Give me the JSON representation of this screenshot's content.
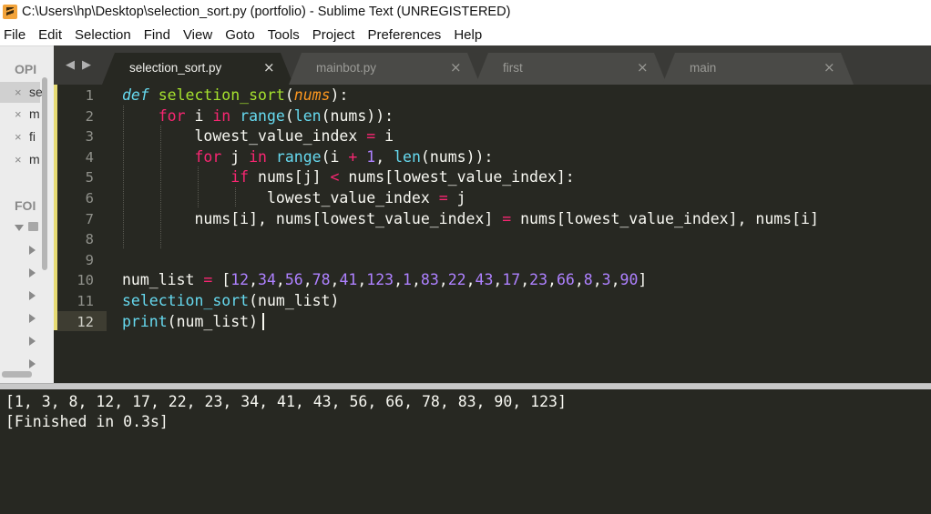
{
  "window": {
    "title": "C:\\Users\\hp\\Desktop\\selection_sort.py (portfolio) - Sublime Text (UNREGISTERED)"
  },
  "menu": [
    "File",
    "Edit",
    "Selection",
    "Find",
    "View",
    "Goto",
    "Tools",
    "Project",
    "Preferences",
    "Help"
  ],
  "sidebar": {
    "open_files_heading": "OPI",
    "open_files": [
      {
        "close": "×",
        "name": "se"
      },
      {
        "close": "×",
        "name": "m"
      },
      {
        "close": "×",
        "name": "fi"
      },
      {
        "close": "×",
        "name": "m"
      }
    ],
    "folders_heading": "FOI"
  },
  "tabs": [
    {
      "label": "selection_sort.py",
      "active": true,
      "close": "×"
    },
    {
      "label": "mainbot.py",
      "active": false,
      "close": "×"
    },
    {
      "label": "first",
      "active": false,
      "close": "×"
    },
    {
      "label": "main",
      "active": false,
      "close": "×"
    }
  ],
  "tab_nav": {
    "prev": "◀",
    "next": "▶"
  },
  "editor": {
    "lines": [
      {
        "num": "1",
        "tokens": [
          {
            "t": "def",
            "c": "d"
          },
          {
            "t": " ",
            "c": ""
          },
          {
            "t": "selection_sort",
            "c": "f"
          },
          {
            "t": "(",
            "c": ""
          },
          {
            "t": "nums",
            "c": "p"
          },
          {
            "t": "):",
            "c": ""
          }
        ]
      },
      {
        "num": "2",
        "tokens": [
          {
            "t": "    ",
            "c": ""
          },
          {
            "t": "for",
            "c": "k"
          },
          {
            "t": " i ",
            "c": ""
          },
          {
            "t": "in",
            "c": "k"
          },
          {
            "t": " ",
            "c": ""
          },
          {
            "t": "range",
            "c": "b"
          },
          {
            "t": "(",
            "c": ""
          },
          {
            "t": "len",
            "c": "b"
          },
          {
            "t": "(nums)):",
            "c": ""
          }
        ]
      },
      {
        "num": "3",
        "tokens": [
          {
            "t": "        lowest_value_index ",
            "c": ""
          },
          {
            "t": "=",
            "c": "k"
          },
          {
            "t": " i",
            "c": ""
          }
        ]
      },
      {
        "num": "4",
        "tokens": [
          {
            "t": "        ",
            "c": ""
          },
          {
            "t": "for",
            "c": "k"
          },
          {
            "t": " j ",
            "c": ""
          },
          {
            "t": "in",
            "c": "k"
          },
          {
            "t": " ",
            "c": ""
          },
          {
            "t": "range",
            "c": "b"
          },
          {
            "t": "(i ",
            "c": ""
          },
          {
            "t": "+",
            "c": "k"
          },
          {
            "t": " ",
            "c": ""
          },
          {
            "t": "1",
            "c": "n"
          },
          {
            "t": ", ",
            "c": ""
          },
          {
            "t": "len",
            "c": "b"
          },
          {
            "t": "(nums)):",
            "c": ""
          }
        ]
      },
      {
        "num": "5",
        "tokens": [
          {
            "t": "            ",
            "c": ""
          },
          {
            "t": "if",
            "c": "k"
          },
          {
            "t": " nums[j] ",
            "c": ""
          },
          {
            "t": "<",
            "c": "k"
          },
          {
            "t": " nums[lowest_value_index]:",
            "c": ""
          }
        ]
      },
      {
        "num": "6",
        "tokens": [
          {
            "t": "                lowest_value_index ",
            "c": ""
          },
          {
            "t": "=",
            "c": "k"
          },
          {
            "t": " j",
            "c": ""
          }
        ]
      },
      {
        "num": "7",
        "tokens": [
          {
            "t": "        nums[i], nums[lowest_value_index] ",
            "c": ""
          },
          {
            "t": "=",
            "c": "k"
          },
          {
            "t": " nums[lowest_value_index], nums[i]",
            "c": ""
          }
        ]
      },
      {
        "num": "8",
        "tokens": []
      },
      {
        "num": "9",
        "tokens": []
      },
      {
        "num": "10",
        "tokens": [
          {
            "t": "num_list ",
            "c": ""
          },
          {
            "t": "=",
            "c": "k"
          },
          {
            "t": " [",
            "c": ""
          },
          {
            "t": "12",
            "c": "n"
          },
          {
            "t": ",",
            "c": ""
          },
          {
            "t": "34",
            "c": "n"
          },
          {
            "t": ",",
            "c": ""
          },
          {
            "t": "56",
            "c": "n"
          },
          {
            "t": ",",
            "c": ""
          },
          {
            "t": "78",
            "c": "n"
          },
          {
            "t": ",",
            "c": ""
          },
          {
            "t": "41",
            "c": "n"
          },
          {
            "t": ",",
            "c": ""
          },
          {
            "t": "123",
            "c": "n"
          },
          {
            "t": ",",
            "c": ""
          },
          {
            "t": "1",
            "c": "n"
          },
          {
            "t": ",",
            "c": ""
          },
          {
            "t": "83",
            "c": "n"
          },
          {
            "t": ",",
            "c": ""
          },
          {
            "t": "22",
            "c": "n"
          },
          {
            "t": ",",
            "c": ""
          },
          {
            "t": "43",
            "c": "n"
          },
          {
            "t": ",",
            "c": ""
          },
          {
            "t": "17",
            "c": "n"
          },
          {
            "t": ",",
            "c": ""
          },
          {
            "t": "23",
            "c": "n"
          },
          {
            "t": ",",
            "c": ""
          },
          {
            "t": "66",
            "c": "n"
          },
          {
            "t": ",",
            "c": ""
          },
          {
            "t": "8",
            "c": "n"
          },
          {
            "t": ",",
            "c": ""
          },
          {
            "t": "3",
            "c": "n"
          },
          {
            "t": ",",
            "c": ""
          },
          {
            "t": "90",
            "c": "n"
          },
          {
            "t": "]",
            "c": ""
          }
        ]
      },
      {
        "num": "11",
        "tokens": [
          {
            "t": "selection_sort",
            "c": "b"
          },
          {
            "t": "(num_list)",
            "c": ""
          }
        ]
      },
      {
        "num": "12",
        "tokens": [
          {
            "t": "print",
            "c": "b"
          },
          {
            "t": "(num_list)",
            "c": ""
          }
        ]
      }
    ]
  },
  "output": {
    "lines": [
      "[1, 3, 8, 12, 17, 22, 23, 34, 41, 43, 56, 66, 78, 83, 90, 123]",
      "[Finished in 0.3s]"
    ]
  },
  "colors": {
    "editor_bg": "#272822",
    "keyword": "#f92672",
    "function": "#a6e22e",
    "builtin": "#66d9ef",
    "param": "#fd971f",
    "number": "#ae81ff"
  }
}
